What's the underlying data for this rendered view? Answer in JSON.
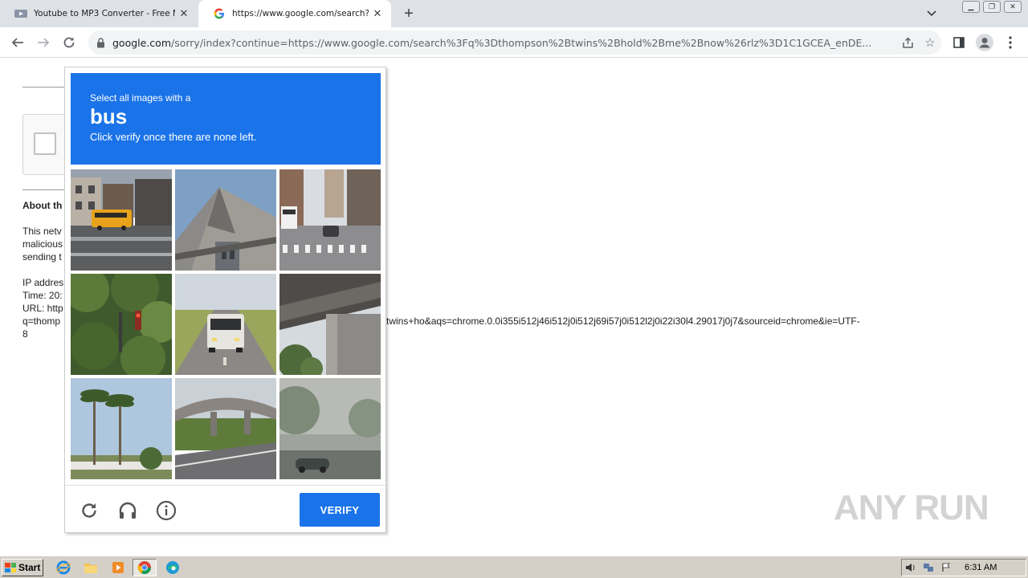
{
  "browser": {
    "tabs": [
      {
        "title": "Youtube to MP3 Converter - Free MP3",
        "active": false
      },
      {
        "title": "https://www.google.com/search?q=",
        "active": true
      }
    ],
    "url_host": "google.com",
    "url_rest": "/sorry/index?continue=https://www.google.com/search%3Fq%3Dthompson%2Btwins%2Bhold%2Bme%2Bnow%26rlz%3D1C1GCEA_enDE..."
  },
  "page": {
    "about_heading": "About th",
    "para": [
      "This netv",
      "malicious",
      "sending t"
    ],
    "ip_label": "IP addres",
    "time_label": "Time: 20:",
    "url_label": "URL: http",
    "url_cont_left": "q=thomp",
    "url_cont_right": "twins+ho&aqs=chrome.0.0i355i512j46i512j0i512j69i57j0i512l2j0i22i30l4.29017j0j7&sourceid=chrome&ie=UTF-",
    "url_end": "8"
  },
  "captcha": {
    "subtitle": "Select all images with a",
    "object": "bus",
    "instruction": "Click verify once there are none left.",
    "verify_label": "VERIFY",
    "tiles": [
      "street with school bus",
      "house roof",
      "city street with bus",
      "trees and traffic light",
      "bus on highway",
      "overpass underside",
      "palm trees",
      "highway overpass",
      "foggy street"
    ]
  },
  "watermark": "ANY RUN",
  "taskbar": {
    "start_label": "Start",
    "clock": "6:31 AM"
  },
  "colors": {
    "accent": "#1a73e8"
  }
}
